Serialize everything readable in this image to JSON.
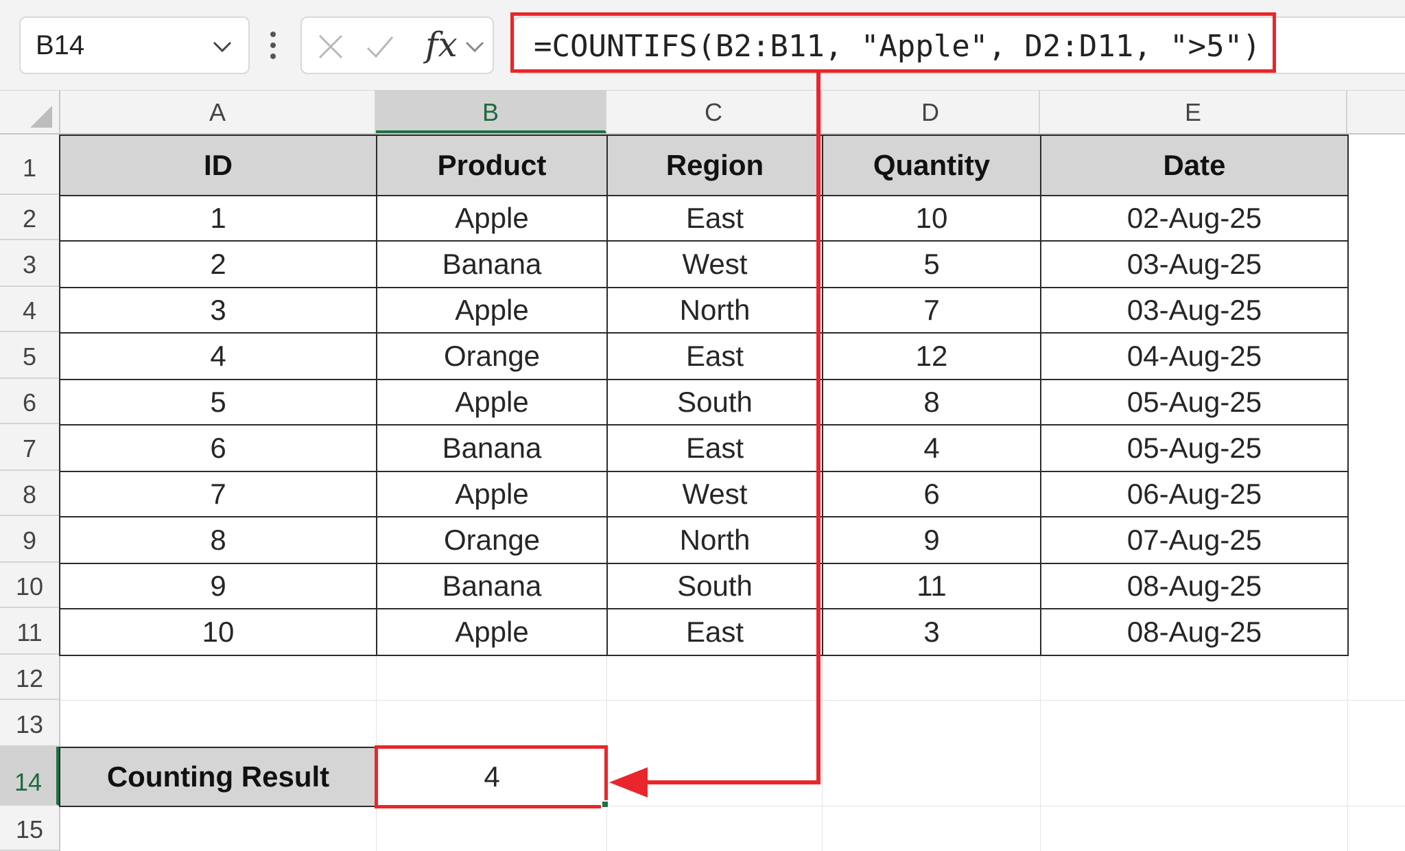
{
  "formula_bar": {
    "name_box": "B14",
    "fx_label": "fx",
    "formula": "=COUNTIFS(B2:B11, \"Apple\", D2:D11, \">5\")"
  },
  "column_headers": [
    "A",
    "B",
    "C",
    "D",
    "E"
  ],
  "row_headers": [
    "1",
    "2",
    "3",
    "4",
    "5",
    "6",
    "7",
    "8",
    "9",
    "10",
    "11",
    "12",
    "13",
    "14",
    "15"
  ],
  "table": {
    "headers": [
      "ID",
      "Product",
      "Region",
      "Quantity",
      "Date"
    ],
    "rows": [
      [
        "1",
        "Apple",
        "East",
        "10",
        "02-Aug-25"
      ],
      [
        "2",
        "Banana",
        "West",
        "5",
        "03-Aug-25"
      ],
      [
        "3",
        "Apple",
        "North",
        "7",
        "03-Aug-25"
      ],
      [
        "4",
        "Orange",
        "East",
        "12",
        "04-Aug-25"
      ],
      [
        "5",
        "Apple",
        "South",
        "8",
        "05-Aug-25"
      ],
      [
        "6",
        "Banana",
        "East",
        "4",
        "05-Aug-25"
      ],
      [
        "7",
        "Apple",
        "West",
        "6",
        "06-Aug-25"
      ],
      [
        "8",
        "Orange",
        "North",
        "9",
        "07-Aug-25"
      ],
      [
        "9",
        "Banana",
        "South",
        "11",
        "08-Aug-25"
      ],
      [
        "10",
        "Apple",
        "East",
        "3",
        "08-Aug-25"
      ]
    ]
  },
  "result": {
    "label": "Counting Result",
    "value": "4"
  },
  "colors": {
    "highlight": "#e8262b",
    "selection": "#1e7145",
    "header_fill": "#d5d5d5"
  }
}
